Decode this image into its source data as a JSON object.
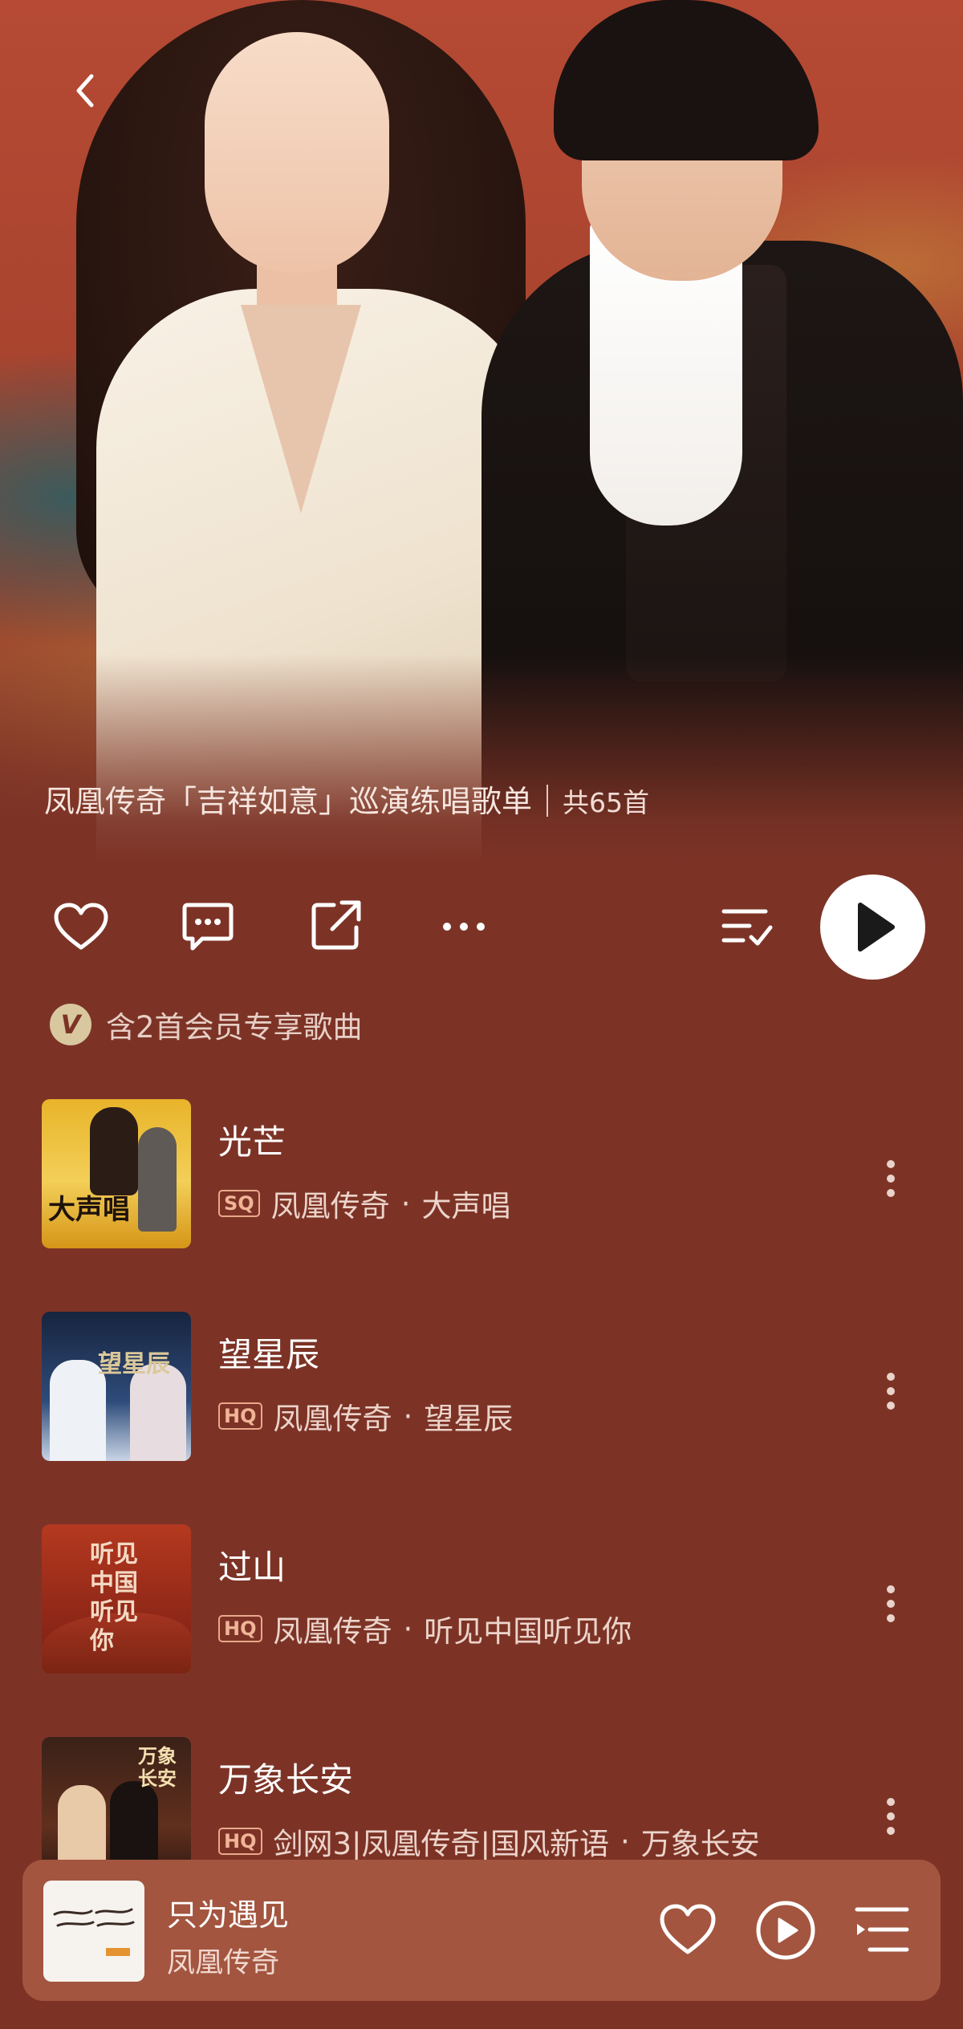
{
  "header": {
    "back_icon": "chevron-left-icon",
    "playlist_title": "凤凰传奇「吉祥如意」巡演练唱歌单",
    "track_count": "共65首"
  },
  "actions": {
    "favorite_icon": "heart-icon",
    "comment_icon": "comment-icon",
    "share_icon": "share-icon",
    "more_icon": "more-horizontal-icon",
    "multi_select_icon": "list-check-icon",
    "play_all_icon": "play-icon"
  },
  "vip_notice": {
    "badge": "V",
    "text": "含2首会员专享歌曲"
  },
  "songs": [
    {
      "title": "光芒",
      "quality": "SQ",
      "artist": "凤凰传奇",
      "album": "大声唱",
      "cover_text": "大声唱"
    },
    {
      "title": "望星辰",
      "quality": "HQ",
      "artist": "凤凰传奇",
      "album": "望星辰",
      "cover_text": "望星辰"
    },
    {
      "title": "过山",
      "quality": "HQ",
      "artist": "凤凰传奇",
      "album": "听见中国听见你",
      "cover_text": "听见中国听见你"
    },
    {
      "title": "万象长安",
      "quality": "HQ",
      "artist": "剑网3|凤凰传奇|国风新语",
      "album": "万象长安",
      "cover_text": "万象长安"
    }
  ],
  "separator": "·",
  "mini_player": {
    "title": "只为遇见",
    "artist": "凤凰传奇",
    "icons": [
      "heart-icon",
      "play-circle-icon",
      "playlist-icon"
    ]
  },
  "colors": {
    "background": "#7c3326",
    "mini_player": "#a3553f",
    "quality_badge": "#f0b497"
  }
}
